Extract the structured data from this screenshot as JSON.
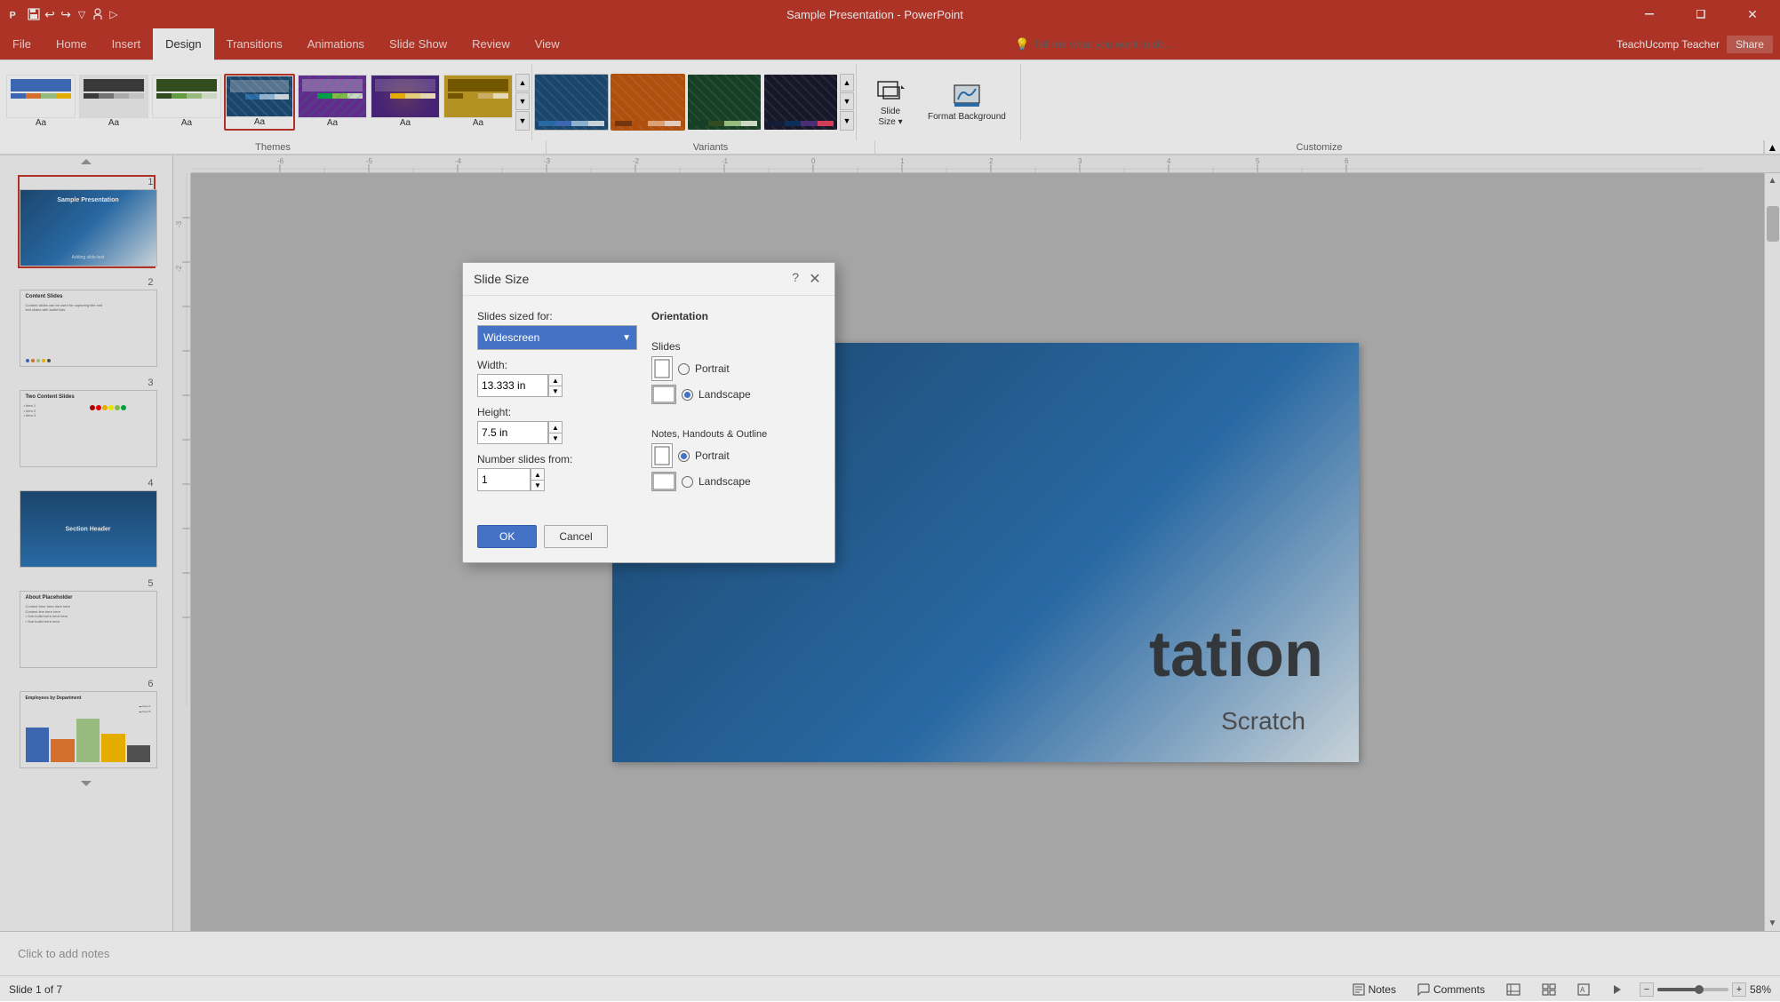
{
  "titlebar": {
    "title": "Sample Presentation - PowerPoint",
    "minimize": "─",
    "restore": "❐",
    "close": "✕"
  },
  "qat": {
    "save_label": "💾",
    "undo_label": "↩",
    "redo_label": "↪",
    "customize_label": "⚙",
    "present_label": "▷"
  },
  "tabs": [
    {
      "label": "File",
      "active": false
    },
    {
      "label": "Home",
      "active": false
    },
    {
      "label": "Insert",
      "active": false
    },
    {
      "label": "Design",
      "active": true
    },
    {
      "label": "Transitions",
      "active": false
    },
    {
      "label": "Animations",
      "active": false
    },
    {
      "label": "Slide Show",
      "active": false
    },
    {
      "label": "Review",
      "active": false
    },
    {
      "label": "View",
      "active": false
    }
  ],
  "tell_me": "💡 Tell me what you want to do...",
  "user": "TeachUcomp Teacher",
  "share": "Share",
  "themes": [
    {
      "label": "Aa",
      "name": "Office Theme"
    },
    {
      "label": "Aa",
      "name": "Theme 2"
    },
    {
      "label": "Aa",
      "name": "Theme 3"
    },
    {
      "label": "Aa",
      "name": "Theme 4 (selected)"
    },
    {
      "label": "Aa",
      "name": "Theme 5"
    },
    {
      "label": "Aa",
      "name": "Theme 6"
    },
    {
      "label": "Aa",
      "name": "Theme 7"
    }
  ],
  "variants": [
    {
      "name": "Variant 1"
    },
    {
      "name": "Variant 2"
    },
    {
      "name": "Variant 3"
    },
    {
      "name": "Variant 4"
    }
  ],
  "customize": {
    "slide_size_label": "Slide\nSize ▾",
    "format_bg_label": "Format\nBackground"
  },
  "group_labels": {
    "themes": "Themes",
    "variants": "Variants",
    "customize": "Customize"
  },
  "slides": [
    {
      "num": "1",
      "title": "Sample Presentation",
      "subtitle": "Adding slide text",
      "selected": true
    },
    {
      "num": "2",
      "title": "Content Slides",
      "selected": false
    },
    {
      "num": "3",
      "title": "Two Content Slides",
      "selected": false
    },
    {
      "num": "4",
      "title": "Section Header",
      "selected": false
    },
    {
      "num": "5",
      "title": "About Placeholder",
      "selected": false
    },
    {
      "num": "6",
      "title": "Employees by Department",
      "selected": false
    }
  ],
  "dialog": {
    "title": "Slide Size",
    "slides_sized_for_label": "Slides sized for:",
    "dropdown_value": "Widescreen",
    "width_label": "Width:",
    "width_value": "13.333 in",
    "height_label": "Height:",
    "height_value": "7.5 in",
    "number_label": "Number slides from:",
    "number_value": "1",
    "orientation_title": "Orientation",
    "slides_group_title": "Slides",
    "portrait_label": "Portrait",
    "landscape_label": "Landscape",
    "notes_group_title": "Notes, Handouts & Outline",
    "notes_portrait_label": "Portrait",
    "notes_landscape_label": "Landscape",
    "ok_label": "OK",
    "cancel_label": "Cancel",
    "slides_landscape_checked": true,
    "notes_portrait_checked": true
  },
  "slide_main": {
    "text1": "tation",
    "text2": "Scratch"
  },
  "notes_placeholder": "Click to add notes",
  "statusbar": {
    "slide_info": "Slide 1 of 7",
    "notes_label": "Notes",
    "comments_label": "Comments",
    "zoom": "58%"
  }
}
